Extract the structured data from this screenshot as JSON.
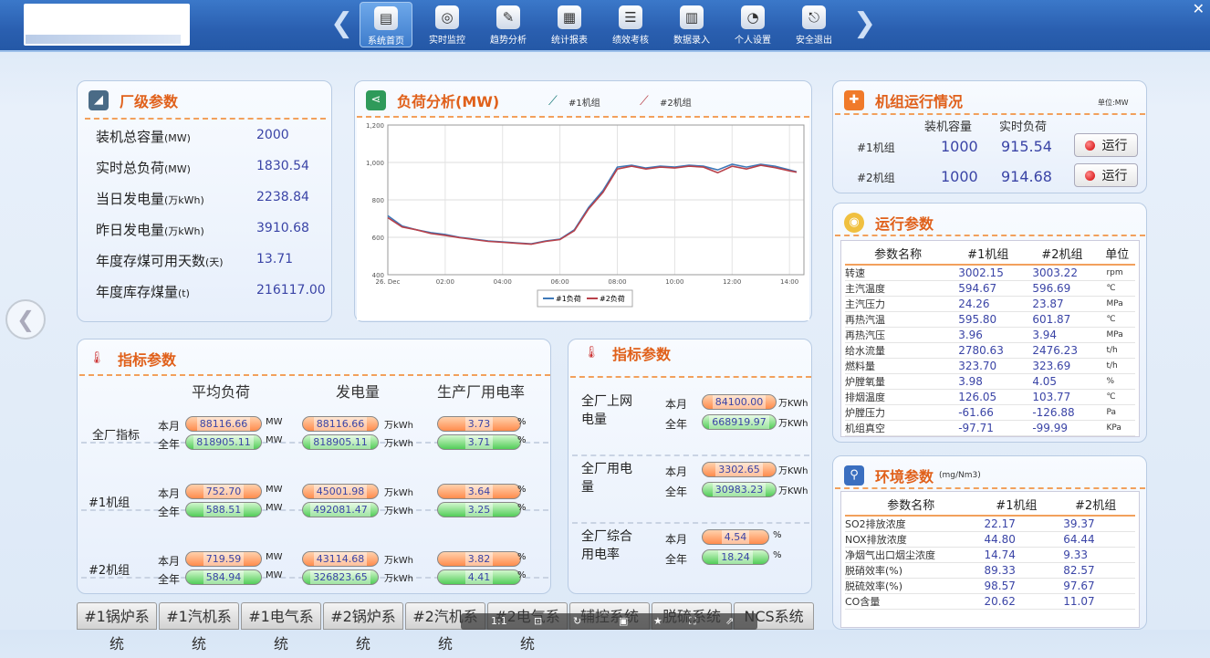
{
  "nav": [
    {
      "label": "系统首页",
      "icon": "home-icon"
    },
    {
      "label": "实时监控",
      "icon": "monitor-icon"
    },
    {
      "label": "趋势分析",
      "icon": "trend-icon"
    },
    {
      "label": "统计报表",
      "icon": "report-icon"
    },
    {
      "label": "绩效考核",
      "icon": "assess-icon"
    },
    {
      "label": "数据录入",
      "icon": "data-entry-icon"
    },
    {
      "label": "个人设置",
      "icon": "settings-icon"
    },
    {
      "label": "安全退出",
      "icon": "logout-icon"
    }
  ],
  "plant": {
    "title": "厂级参数",
    "rows": [
      {
        "label": "装机总容量",
        "unit": "(MW)",
        "value": "2000"
      },
      {
        "label": "实时总负荷",
        "unit": "(MW)",
        "value": "1830.54"
      },
      {
        "label": "当日发电量",
        "unit": "(万kWh)",
        "value": "2238.84"
      },
      {
        "label": "昨日发电量",
        "unit": "(万kWh)",
        "value": "3910.68"
      },
      {
        "label": "年度存煤可用天数",
        "unit": "(天)",
        "value": "13.71"
      },
      {
        "label": "年度库存煤量",
        "unit": "(t)",
        "value": "216117.00"
      }
    ]
  },
  "load": {
    "title": "负荷分析(MW)",
    "legend1": "#1机组",
    "legend2": "#2机组",
    "bottom1": "#1负荷",
    "bottom2": "#2负荷"
  },
  "chart_data": {
    "type": "line",
    "x": [
      "00:00",
      "00:30",
      "01:00",
      "01:30",
      "02:00",
      "02:30",
      "03:00",
      "03:30",
      "04:00",
      "04:30",
      "05:00",
      "05:30",
      "06:00",
      "06:30",
      "07:00",
      "07:30",
      "08:00",
      "08:30",
      "09:00",
      "09:30",
      "10:00",
      "10:30",
      "11:00",
      "11:30",
      "12:00",
      "12:30",
      "13:00",
      "13:30",
      "14:00",
      "14:15"
    ],
    "series": [
      {
        "name": "#1负荷",
        "values": [
          715,
          660,
          640,
          625,
          615,
          600,
          590,
          580,
          575,
          570,
          565,
          580,
          590,
          640,
          760,
          850,
          975,
          985,
          970,
          980,
          975,
          985,
          980,
          960,
          990,
          975,
          990,
          980,
          960,
          950
        ]
      },
      {
        "name": "#2负荷",
        "values": [
          705,
          655,
          640,
          620,
          610,
          598,
          588,
          578,
          573,
          568,
          563,
          578,
          588,
          635,
          752,
          840,
          965,
          980,
          965,
          975,
          970,
          980,
          975,
          945,
          980,
          965,
          985,
          972,
          955,
          948
        ]
      }
    ],
    "xticks": [
      "26. Dec",
      "02:00",
      "04:00",
      "06:00",
      "08:00",
      "10:00",
      "12:00",
      "14:00"
    ],
    "yticks": [
      "1,200",
      "1,000",
      "800",
      "600",
      "400"
    ],
    "ylim": [
      400,
      1200
    ],
    "grid": true,
    "legend": "top"
  },
  "units": {
    "title": "机组运行情况",
    "unit_note": "单位:MW",
    "col1": "装机容量",
    "col2": "实时负荷",
    "rows": [
      {
        "name": "#1机组",
        "cap": "1000",
        "load": "915.54",
        "state": "运行"
      },
      {
        "name": "#2机组",
        "cap": "1000",
        "load": "914.68",
        "state": "运行"
      }
    ]
  },
  "ops": {
    "title": "运行参数",
    "headers": [
      "参数名称",
      "#1机组",
      "#2机组",
      "单位"
    ],
    "rows": [
      [
        "转速",
        "3002.15",
        "3003.22",
        "rpm"
      ],
      [
        "主汽温度",
        "594.67",
        "596.69",
        "℃"
      ],
      [
        "主汽压力",
        "24.26",
        "23.87",
        "MPa"
      ],
      [
        "再热汽温",
        "595.80",
        "601.87",
        "℃"
      ],
      [
        "再热汽压",
        "3.96",
        "3.94",
        "MPa"
      ],
      [
        "给水流量",
        "2780.63",
        "2476.23",
        "t/h"
      ],
      [
        "燃料量",
        "323.70",
        "323.69",
        "t/h"
      ],
      [
        "炉膛氧量",
        "3.98",
        "4.05",
        "%"
      ],
      [
        "排烟温度",
        "126.05",
        "103.77",
        "℃"
      ],
      [
        "炉膛压力",
        "-61.66",
        "-126.88",
        "Pa"
      ],
      [
        "机组真空",
        "-97.71",
        "-99.99",
        "KPa"
      ]
    ]
  },
  "env": {
    "title": "环境参数",
    "unit": "(mg/Nm3)",
    "headers": [
      "参数名称",
      "#1机组",
      "#2机组"
    ],
    "rows": [
      [
        "SO2排放浓度",
        "22.17",
        "39.37"
      ],
      [
        "NOX排放浓度",
        "44.80",
        "64.44"
      ],
      [
        "净烟气出口烟尘浓度",
        "14.74",
        "9.33"
      ],
      [
        "脱硝效率(%)",
        "89.33",
        "82.57"
      ],
      [
        "脱硫效率(%)",
        "98.57",
        "97.67"
      ],
      [
        "CO含量",
        "20.62",
        "11.07"
      ]
    ]
  },
  "idx": {
    "title": "指标参数",
    "cols": [
      "平均负荷",
      "发电量",
      "生产厂用电率"
    ],
    "month": "本月",
    "year": "全年",
    "rows": [
      {
        "name": "全厂指标",
        "avg": [
          "88116.66",
          "818905.11"
        ],
        "avg_u": "MW",
        "gen": [
          "88116.66",
          "818905.11"
        ],
        "gen_u": "万kWh",
        "rate": [
          "3.73",
          "3.71"
        ],
        "rate_u": "%"
      },
      {
        "name": "#1机组",
        "avg": [
          "752.70",
          "588.51"
        ],
        "avg_u": "MW",
        "gen": [
          "45001.98",
          "492081.47"
        ],
        "gen_u": "万kWh",
        "rate": [
          "3.64",
          "3.25"
        ],
        "rate_u": "%"
      },
      {
        "name": "#2机组",
        "avg": [
          "719.59",
          "584.94"
        ],
        "avg_u": "MW",
        "gen": [
          "43114.68",
          "326823.65"
        ],
        "gen_u": "万kWh",
        "rate": [
          "3.82",
          "4.41"
        ],
        "rate_u": "%"
      }
    ]
  },
  "idx2": {
    "title": "指标参数",
    "rows": [
      {
        "name": "全厂上网电量",
        "m": "84100.00",
        "y": "668919.97",
        "u": "万KWh"
      },
      {
        "name": "全厂用电量",
        "m": "3302.65",
        "y": "30983.23",
        "u": "万KWh"
      },
      {
        "name": "全厂综合用电率",
        "m": "4.54",
        "y": "18.24",
        "u": "%"
      }
    ]
  },
  "tabs": [
    "#1锅炉系统",
    "#1汽机系统",
    "#1电气系统",
    "#2锅炉系统",
    "#2汽机系统",
    "#2电气系统",
    "辅控系统",
    "脱硫系统",
    "NCS系统"
  ],
  "colors": {
    "accent": "#e0601a",
    "value": "#3a44a6",
    "series1": "#3d78b8",
    "series2": "#b8414a"
  }
}
